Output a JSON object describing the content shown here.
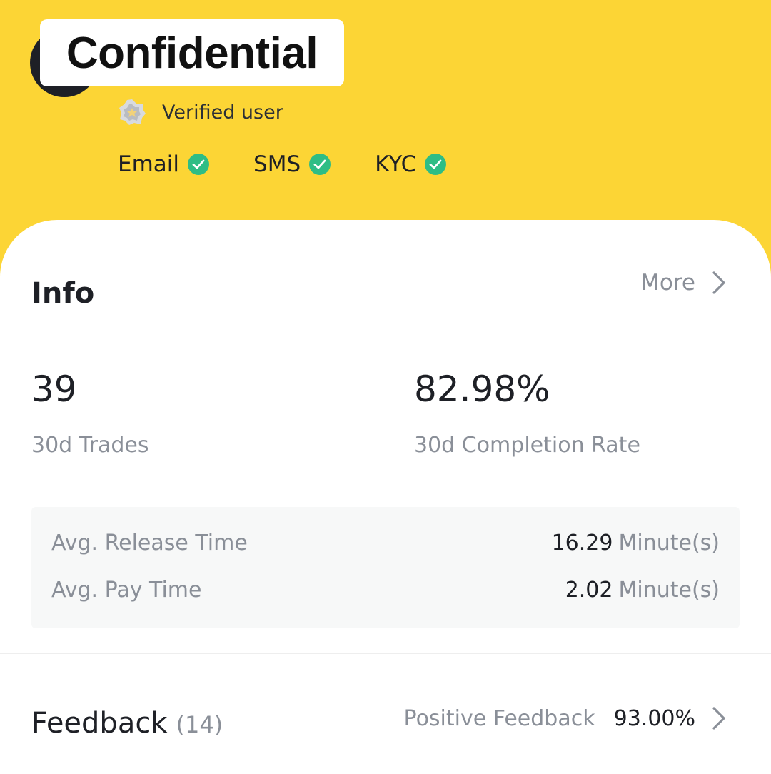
{
  "header": {
    "redaction_label": "Confidential",
    "verified_text": "Verified user",
    "verifications": [
      {
        "label": "Email",
        "icon": "check-circle-icon"
      },
      {
        "label": "SMS",
        "icon": "check-circle-icon"
      },
      {
        "label": "KYC",
        "icon": "check-circle-icon"
      }
    ]
  },
  "info": {
    "title": "Info",
    "more_label": "More",
    "trades_value": "39",
    "trades_label": "30d Trades",
    "completion_value": "82.98%",
    "completion_label": "30d Completion Rate",
    "release_label": "Avg. Release Time",
    "release_value": "16.29",
    "release_unit": "Minute(s)",
    "pay_label": "Avg. Pay Time",
    "pay_value": "2.02",
    "pay_unit": "Minute(s)"
  },
  "feedback": {
    "title": "Feedback",
    "count": "(14)",
    "positive_label": "Positive Feedback",
    "positive_value": "93.00%"
  },
  "colors": {
    "brand_yellow": "#fcd535",
    "check_green": "#2ebd85",
    "text_primary": "#1e2026",
    "text_secondary": "#8a8f98"
  }
}
